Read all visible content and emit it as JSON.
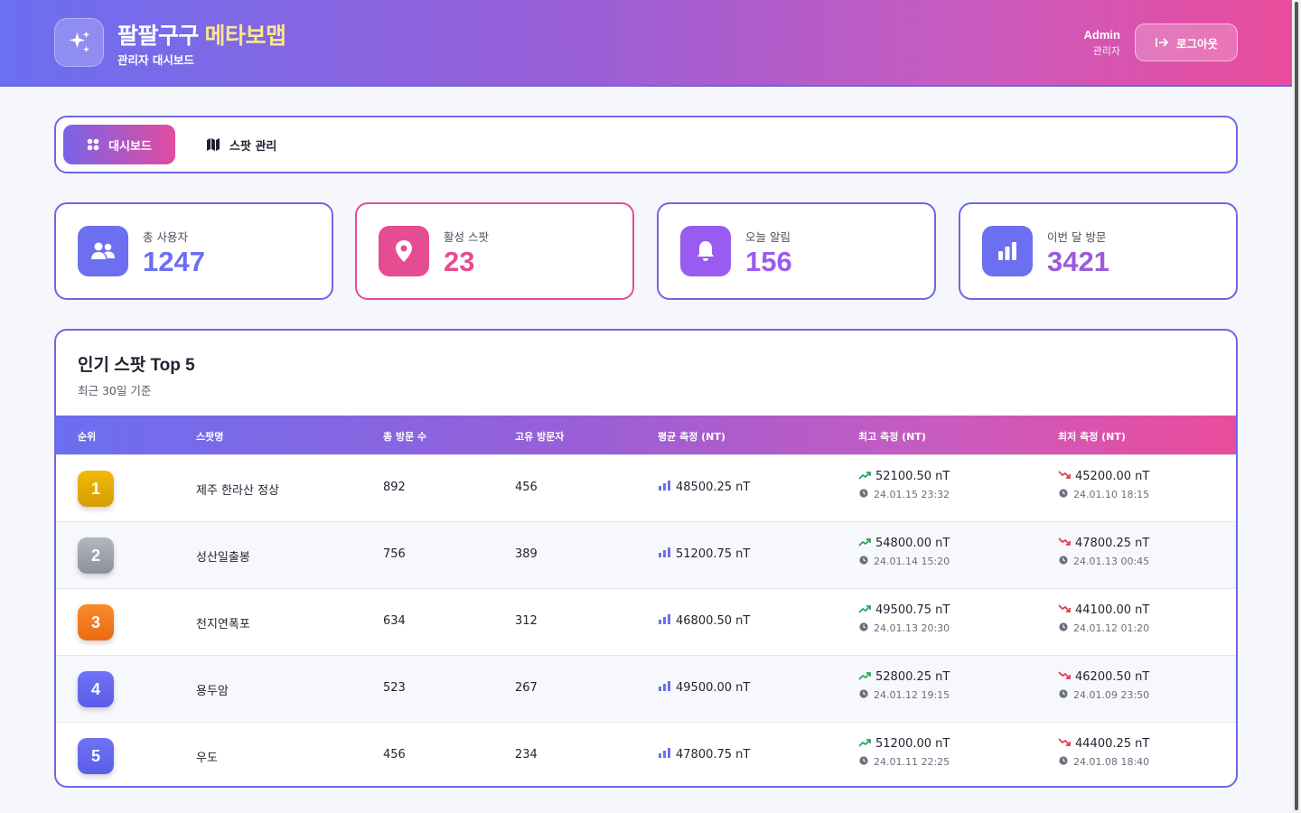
{
  "header": {
    "brand_main": "팔팔구구 ",
    "brand_accent": "메타보맵",
    "subtitle": "관리자 대시보드",
    "admin_name": "Admin",
    "admin_role": "관리자",
    "logout_label": "로그아웃",
    "gradient": [
      "#6b6ff0",
      "#ea4c9c"
    ]
  },
  "tabs": [
    {
      "label": "대시보드",
      "active": true
    },
    {
      "label": "스팟 관리",
      "active": false
    }
  ],
  "stats": [
    {
      "label": "총 사용자",
      "value": "1247",
      "icon": "users-icon",
      "color": "#6b6ff0"
    },
    {
      "label": "활성 스팟",
      "value": "23",
      "icon": "map-pin-icon",
      "color": "#e64c92"
    },
    {
      "label": "오늘 알림",
      "value": "156",
      "icon": "bell-icon",
      "color": "#9a5cf0"
    },
    {
      "label": "이번 달 방문",
      "value": "3421",
      "icon": "bar-chart-icon",
      "color": "#6b6ff0"
    }
  ],
  "table": {
    "title": "인기 스팟 Top 5",
    "subtitle": "최근 30일 기준",
    "headers": [
      "순위",
      "스팟명",
      "총 방문 수",
      "고유 방문자",
      "평균 측정 (NT)",
      "최고 측정 (NT)",
      "최저 측정 (NT)"
    ],
    "rows": [
      {
        "rank": "1",
        "name": "제주 한라산 정상",
        "visits": "892",
        "unique": "456",
        "avg": "48500.25 nT",
        "max": "52100.50 nT",
        "max_time": "24.01.15 23:32",
        "min": "45200.00 nT",
        "min_time": "24.01.10 18:15"
      },
      {
        "rank": "2",
        "name": "성산일출봉",
        "visits": "756",
        "unique": "389",
        "avg": "51200.75 nT",
        "max": "54800.00 nT",
        "max_time": "24.01.14 15:20",
        "min": "47800.25 nT",
        "min_time": "24.01.13 00:45"
      },
      {
        "rank": "3",
        "name": "천지연폭포",
        "visits": "634",
        "unique": "312",
        "avg": "46800.50 nT",
        "max": "49500.75 nT",
        "max_time": "24.01.13 20:30",
        "min": "44100.00 nT",
        "min_time": "24.01.12 01:20"
      },
      {
        "rank": "4",
        "name": "용두암",
        "visits": "523",
        "unique": "267",
        "avg": "49500.00 nT",
        "max": "52800.25 nT",
        "max_time": "24.01.12 19:15",
        "min": "46200.50 nT",
        "min_time": "24.01.09 23:50"
      },
      {
        "rank": "5",
        "name": "우도",
        "visits": "456",
        "unique": "234",
        "avg": "47800.75 nT",
        "max": "51200.00 nT",
        "max_time": "24.01.11 22:25",
        "min": "44400.25 nT",
        "min_time": "24.01.08 18:40"
      }
    ],
    "rank_colors": [
      "#eab308",
      "#9ca3af",
      "#f97316",
      "#6366f1",
      "#6366f1"
    ]
  }
}
